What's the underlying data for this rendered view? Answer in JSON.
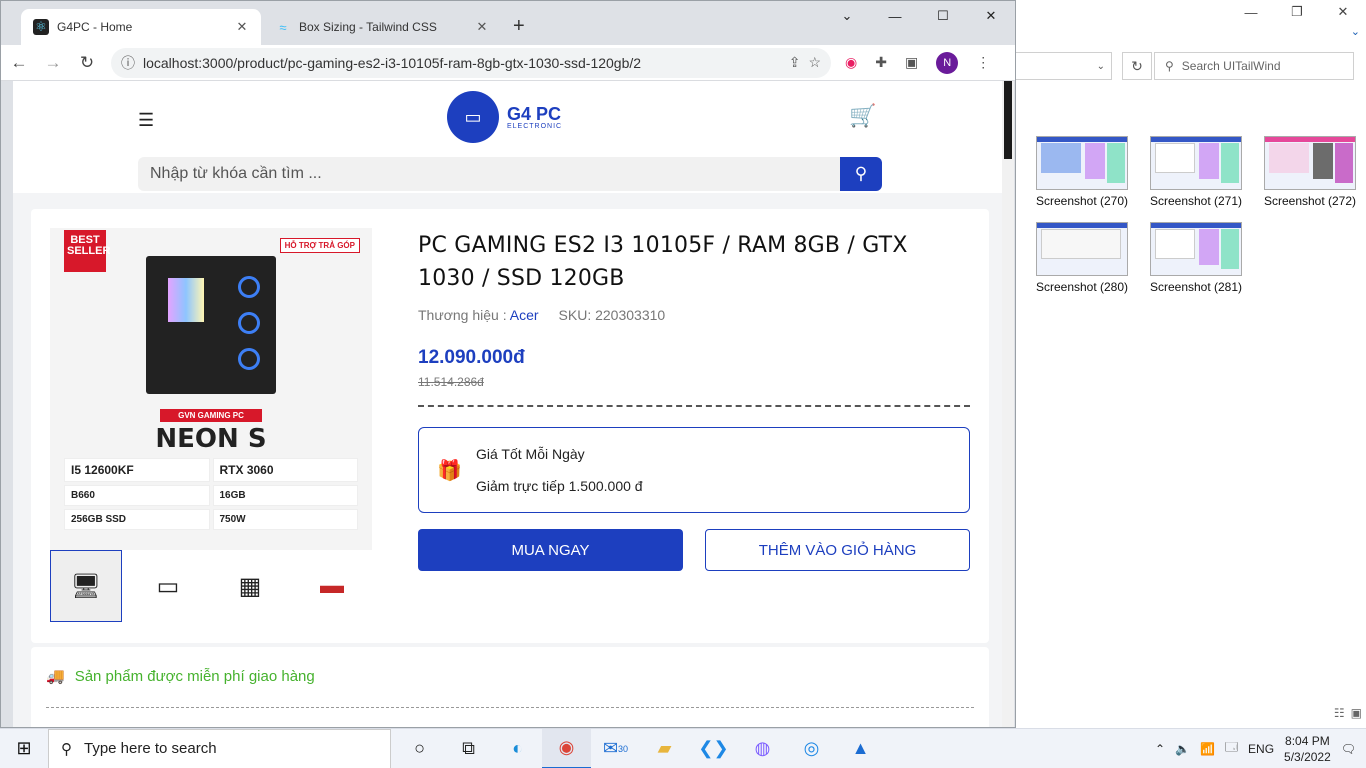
{
  "explorer": {
    "minimize": "—",
    "maximize": "❐",
    "close": "✕",
    "search_placeholder": "Search UITailWind",
    "files": [
      {
        "name": "Screenshot (270)"
      },
      {
        "name": "Screenshot (271)"
      },
      {
        "name": "Screenshot (272)"
      },
      {
        "name": "Screenshot (280)"
      },
      {
        "name": "Screenshot (281)"
      }
    ]
  },
  "browser": {
    "tabs": [
      {
        "title": "G4PC - Home",
        "active": true
      },
      {
        "title": "Box Sizing - Tailwind CSS",
        "active": false
      }
    ],
    "url": "localhost:3000/product/pc-gaming-es2-i3-10105f-ram-8gb-gtx-1030-ssd-120gb/2",
    "profile_initial": "N"
  },
  "site": {
    "logo_name": "G4 PC",
    "logo_sub": "ELECTRONIC",
    "search_placeholder": "Nhập từ khóa cần tìm ..."
  },
  "product": {
    "title": "PC GAMING ES2 I3 10105F / RAM 8GB / GTX 1030 / SSD 120GB",
    "brand_label": "Thương hiệu :",
    "brand": "Acer",
    "sku": "SKU: 220303310",
    "price": "12.090.000đ",
    "old_price": "11.514.286đ",
    "promo_title": "Giá Tốt Mỗi Ngày",
    "promo_desc": "Giảm trực tiếp 1.500.000 đ",
    "buy_label": "MUA NGAY",
    "cart_label": "THÊM VÀO GIỎ HÀNG",
    "image": {
      "badge": "BEST SELLER",
      "install": "HỖ TRỢ TRẢ GÓP",
      "strip": "GVN GAMING PC",
      "model": "NEON S",
      "specs": [
        "I5 12600KF",
        "RTX 3060",
        "B660",
        "16GB",
        "256GB SSD",
        "750W"
      ]
    }
  },
  "shipping": {
    "text": "Sản phẩm được miễn phí giao hàng"
  },
  "taskbar": {
    "search_placeholder": "Type here to search",
    "lang": "ENG",
    "time": "8:04 PM",
    "date": "5/3/2022",
    "mail_badge": "30"
  }
}
